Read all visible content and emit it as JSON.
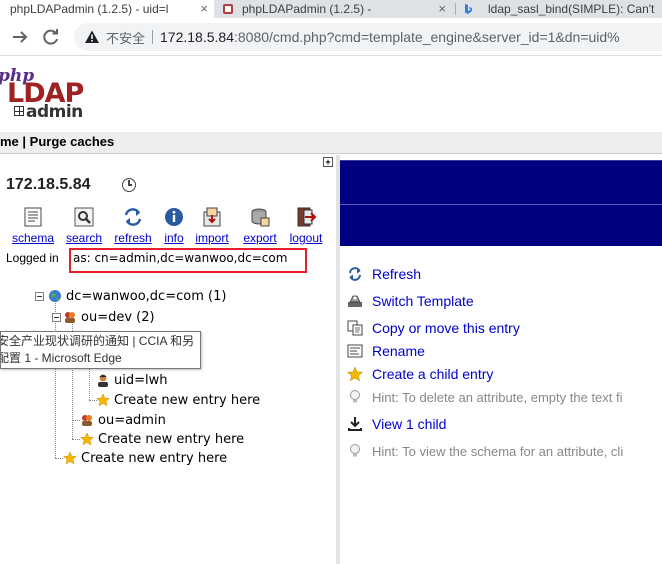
{
  "browser": {
    "tabs": [
      {
        "title": "phpLDAPadmin (1.2.5) - uid=l",
        "active": true
      },
      {
        "title": "phpLDAPadmin (1.2.5) -",
        "active": false
      },
      {
        "title": "ldap_sasl_bind(SIMPLE): Can't",
        "active": false
      }
    ],
    "close_glyph": "×",
    "address": {
      "security_label": "不安全",
      "host": "172.18.5.84",
      "path": ":8080/cmd.php?cmd=template_engine&server_id=1&dn=uid%"
    }
  },
  "logo": {
    "php": "php",
    "ldap": "LDAP",
    "admin": "admin"
  },
  "topnav": {
    "home": "me",
    "separator": " | ",
    "purge": "Purge caches"
  },
  "server": {
    "name": "172.18.5.84"
  },
  "commands": [
    {
      "label": "schema",
      "icon": "schema-icon"
    },
    {
      "label": "search",
      "icon": "search-icon"
    },
    {
      "label": "refresh",
      "icon": "refresh-icon"
    },
    {
      "label": "info",
      "icon": "info-icon"
    },
    {
      "label": "import",
      "icon": "import-icon"
    },
    {
      "label": "export",
      "icon": "export-icon"
    },
    {
      "label": "logout",
      "icon": "logout-icon"
    }
  ],
  "login": {
    "prefix": "Logged in",
    "dn": "as: cn=admin,dc=wanwoo,dc=com"
  },
  "tree": {
    "root": "dc=wanwoo,dc=com (1)",
    "ou_dev": "ou=dev (2)",
    "uid_lwh": "uid=lwh",
    "create_label": "Create new entry here",
    "ou_admin": "ou=admin"
  },
  "tooltip": {
    "line1": "安全产业现状调研的通知 | CCIA 和另",
    "line2": "配置 1 - Microsoft Edge"
  },
  "actions": {
    "refresh": "Refresh",
    "switch_template": "Switch Template",
    "copy_move": "Copy or move this entry",
    "rename": "Rename",
    "create_child": "Create a child entry",
    "hint_delete": "Hint: To delete an attribute, empty the text fi",
    "view_child": "View 1 child",
    "hint_schema": "Hint: To view the schema for an attribute, cli"
  },
  "colors": {
    "banner": "#000080",
    "link": "#0000cc",
    "highlight_box": "#e8202a"
  }
}
